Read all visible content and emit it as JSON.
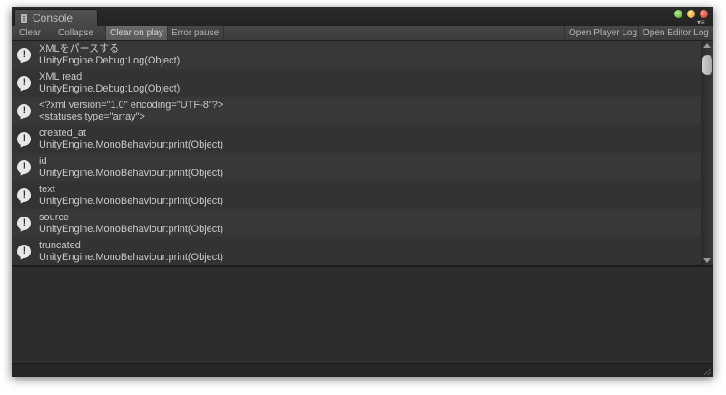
{
  "window": {
    "tab_label": "Console"
  },
  "toolbar": {
    "clear": "Clear",
    "collapse": "Collapse",
    "clear_on_play": "Clear on play",
    "error_pause": "Error pause",
    "open_player_log": "Open Player Log",
    "open_editor_log": "Open Editor Log"
  },
  "logs": [
    {
      "line1": "XMLをパースする",
      "line2": "UnityEngine.Debug:Log(Object)"
    },
    {
      "line1": "XML read",
      "line2": "UnityEngine.Debug:Log(Object)"
    },
    {
      "line1": "<?xml version=\"1.0\" encoding=\"UTF-8\"?>",
      "line2": "<statuses type=\"array\">"
    },
    {
      "line1": "created_at",
      "line2": "UnityEngine.MonoBehaviour:print(Object)"
    },
    {
      "line1": "id",
      "line2": "UnityEngine.MonoBehaviour:print(Object)"
    },
    {
      "line1": "text",
      "line2": "UnityEngine.MonoBehaviour:print(Object)"
    },
    {
      "line1": "source",
      "line2": "UnityEngine.MonoBehaviour:print(Object)"
    },
    {
      "line1": "truncated",
      "line2": "UnityEngine.MonoBehaviour:print(Object)"
    }
  ],
  "icons": {
    "tab": "console-tab-icon",
    "log": "info-message-icon",
    "window_controls": [
      "green-window-button",
      "yellow-window-button",
      "red-window-button"
    ],
    "menu": "dropdown-menu-icon"
  },
  "colors": {
    "background": "#2f2f2f",
    "text": "#c9c9c9",
    "row_even": "#383838",
    "row_odd": "#333333",
    "active_button": "#626262"
  }
}
